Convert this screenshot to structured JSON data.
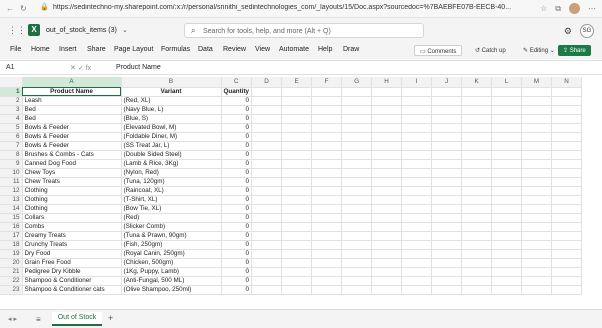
{
  "browser": {
    "url": "https://sedintechno-my.sharepoint.com/:x:/r/personal/srinithi_sedintechnologies_com/_layouts/15/Doc.aspx?sourcedoc=%7BAEBFE07B-EECB-40..."
  },
  "header": {
    "file_title": "out_of_stock_items (3)",
    "search_placeholder": "Search for tools, help, and more (Alt + Q)",
    "avatar_initials": "SG"
  },
  "ribbon": {
    "tabs": [
      "File",
      "Home",
      "Insert",
      "Share",
      "Page Layout",
      "Formulas",
      "Data",
      "Review",
      "View",
      "Automate",
      "Help",
      "Draw"
    ],
    "comments": "Comments",
    "catch_up": "Catch up",
    "editing": "Editing",
    "share": "Share"
  },
  "formula_bar": {
    "cell_ref": "A1",
    "fx": "fx",
    "value": "Product Name"
  },
  "grid": {
    "columns": [
      "A",
      "B",
      "C",
      "D",
      "E",
      "F",
      "G",
      "H",
      "I",
      "J",
      "K",
      "L",
      "M",
      "N"
    ],
    "headers": [
      "Product Name",
      "Variant",
      "Quantity"
    ],
    "rows": [
      [
        "Leash",
        "(Red, XL)",
        "0"
      ],
      [
        "Bed",
        "(Navy Blue, L)",
        "0"
      ],
      [
        "Bed",
        "(Blue, S)",
        "0"
      ],
      [
        "Bowls & Feeder",
        "(Elevated Bowl, M)",
        "0"
      ],
      [
        "Bowls & Feeder",
        "(Foldable Diner, M)",
        "0"
      ],
      [
        "Bowls & Feeder",
        "(SS Treat Jar, L)",
        "0"
      ],
      [
        "Brushes & Combs - Cats",
        "(Double Sided Steel)",
        "0"
      ],
      [
        "Canned Dog Food",
        "(Lamb & Rice, 3Kg)",
        "0"
      ],
      [
        "Chew Toys",
        "(Nylon, Red)",
        "0"
      ],
      [
        "Chew Treats",
        "(Tuna, 120gm)",
        "0"
      ],
      [
        "Clothing",
        "(Raincoat, XL)",
        "0"
      ],
      [
        "Clothing",
        "(T-Shirt, XL)",
        "0"
      ],
      [
        "Clothing",
        "(Bow Tie, XL)",
        "0"
      ],
      [
        "Collars",
        "(Red)",
        "0"
      ],
      [
        "Combs",
        "(Slicker Comb)",
        "0"
      ],
      [
        "Creamy Treats",
        "(Tuna & Prawn, 90gm)",
        "0"
      ],
      [
        "Crunchy Treats",
        "(Fish, 250gm)",
        "0"
      ],
      [
        "Dry Food",
        "(Royal Canin, 250gm)",
        "0"
      ],
      [
        "Grain Free Food",
        "(Chicken, 500gm)",
        "0"
      ],
      [
        "Pedigree Dry Kibble",
        "(1Kg, Puppy, Lamb)",
        "0"
      ],
      [
        "Shampoo & Conditioner",
        "(Anti-Fungal, 500 ML)",
        "0"
      ],
      [
        "Shampoo & Conditioner cats",
        "(Olive Shampoo, 250ml)",
        "0"
      ]
    ]
  },
  "sheets": {
    "active": "Out of Stock",
    "add": "+"
  }
}
